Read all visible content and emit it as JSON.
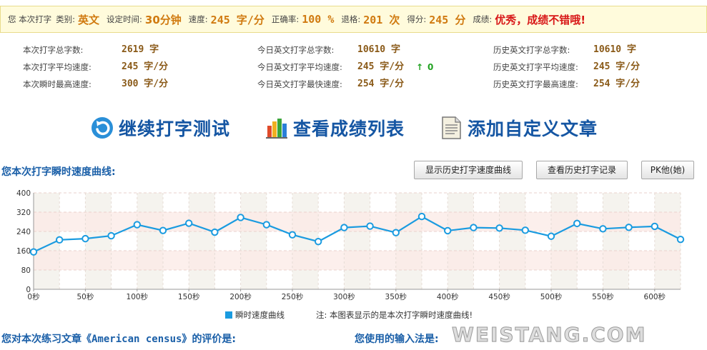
{
  "summary": {
    "prefix": "您 本次打字",
    "category_label": "类别:",
    "category": "英文",
    "time_label": "设定时间:",
    "time": "30分钟",
    "speed_label": "速度:",
    "speed": "245 字/分",
    "accuracy_label": "正确率:",
    "accuracy": "100 %",
    "backspace_label": "退格:",
    "backspace": "201 次",
    "score_label": "得分:",
    "score": "245 分",
    "grade_label": "成绩:",
    "grade": "优秀，成绩不错哦!"
  },
  "stats": {
    "col1": [
      {
        "label": "本次打字总字数:",
        "value": "2619 字"
      },
      {
        "label": "本次打字平均速度:",
        "value": "245 字/分"
      },
      {
        "label": "本次瞬时最高速度:",
        "value": "300 字/分"
      }
    ],
    "col2": [
      {
        "label": "今日英文打字总字数:",
        "value": "10610 字"
      },
      {
        "label": "今日英文打字平均速度:",
        "value": "245 字/分",
        "delta": "0"
      },
      {
        "label": "今日英文打字最快速度:",
        "value": "254 字/分"
      }
    ],
    "col3": [
      {
        "label": "历史英文打字总字数:",
        "value": "10610 字"
      },
      {
        "label": "历史英文打字平均速度:",
        "value": "245 字/分"
      },
      {
        "label": "历史英文打字最高速度:",
        "value": "254 字/分"
      }
    ]
  },
  "actions": {
    "continue": "继续打字测试",
    "results": "查看成绩列表",
    "add_article": "添加自定义文章"
  },
  "section": {
    "title": "您本次打字瞬时速度曲线:",
    "btn_history_curve": "显示历史打字速度曲线",
    "btn_history_records": "查看历史打字记录",
    "btn_pk": "PK他(她)"
  },
  "legend": {
    "series": "瞬时速度曲线",
    "note": "注: 本图表显示的是本次打字瞬时速度曲线!"
  },
  "bottom": {
    "comment_prefix": "您对本次练习文章",
    "article": "《American census》",
    "comment_suffix": "的评价是:",
    "input_method": "您使用的输入法是:"
  },
  "watermark": "WEISTANG.COM",
  "colors": {
    "line": "#1a9be0",
    "band": "#fbe9e6",
    "accent": "#d07a10",
    "grade": "#d81818",
    "title_blue": "#1a5fa8"
  },
  "chart_data": {
    "type": "line",
    "x": [
      0,
      25,
      50,
      75,
      100,
      125,
      150,
      175,
      200,
      225,
      250,
      275,
      300,
      325,
      350,
      375,
      400,
      425,
      450,
      475,
      500,
      525,
      550,
      575,
      600,
      625
    ],
    "series": [
      {
        "name": "瞬时速度曲线",
        "values": [
          155,
          205,
          210,
          222,
          268,
          244,
          274,
          237,
          298,
          268,
          226,
          198,
          256,
          262,
          235,
          302,
          243,
          256,
          254,
          245,
          220,
          273,
          251,
          257,
          261,
          207
        ]
      }
    ],
    "xlim": [
      0,
      625
    ],
    "ylim": [
      0,
      400
    ],
    "x_ticks": [
      0,
      50,
      100,
      150,
      200,
      250,
      300,
      350,
      400,
      450,
      500,
      550,
      600
    ],
    "x_tick_labels": [
      "0秒",
      "50秒",
      "100秒",
      "150秒",
      "200秒",
      "250秒",
      "300秒",
      "350秒",
      "400秒",
      "450秒",
      "500秒",
      "550秒",
      "600秒"
    ],
    "y_ticks": [
      0,
      80,
      160,
      240,
      320,
      400
    ],
    "y_tick_labels": [
      "0",
      "80",
      "160",
      "240",
      "320",
      "400"
    ],
    "grid": true,
    "legend": "bottom"
  }
}
